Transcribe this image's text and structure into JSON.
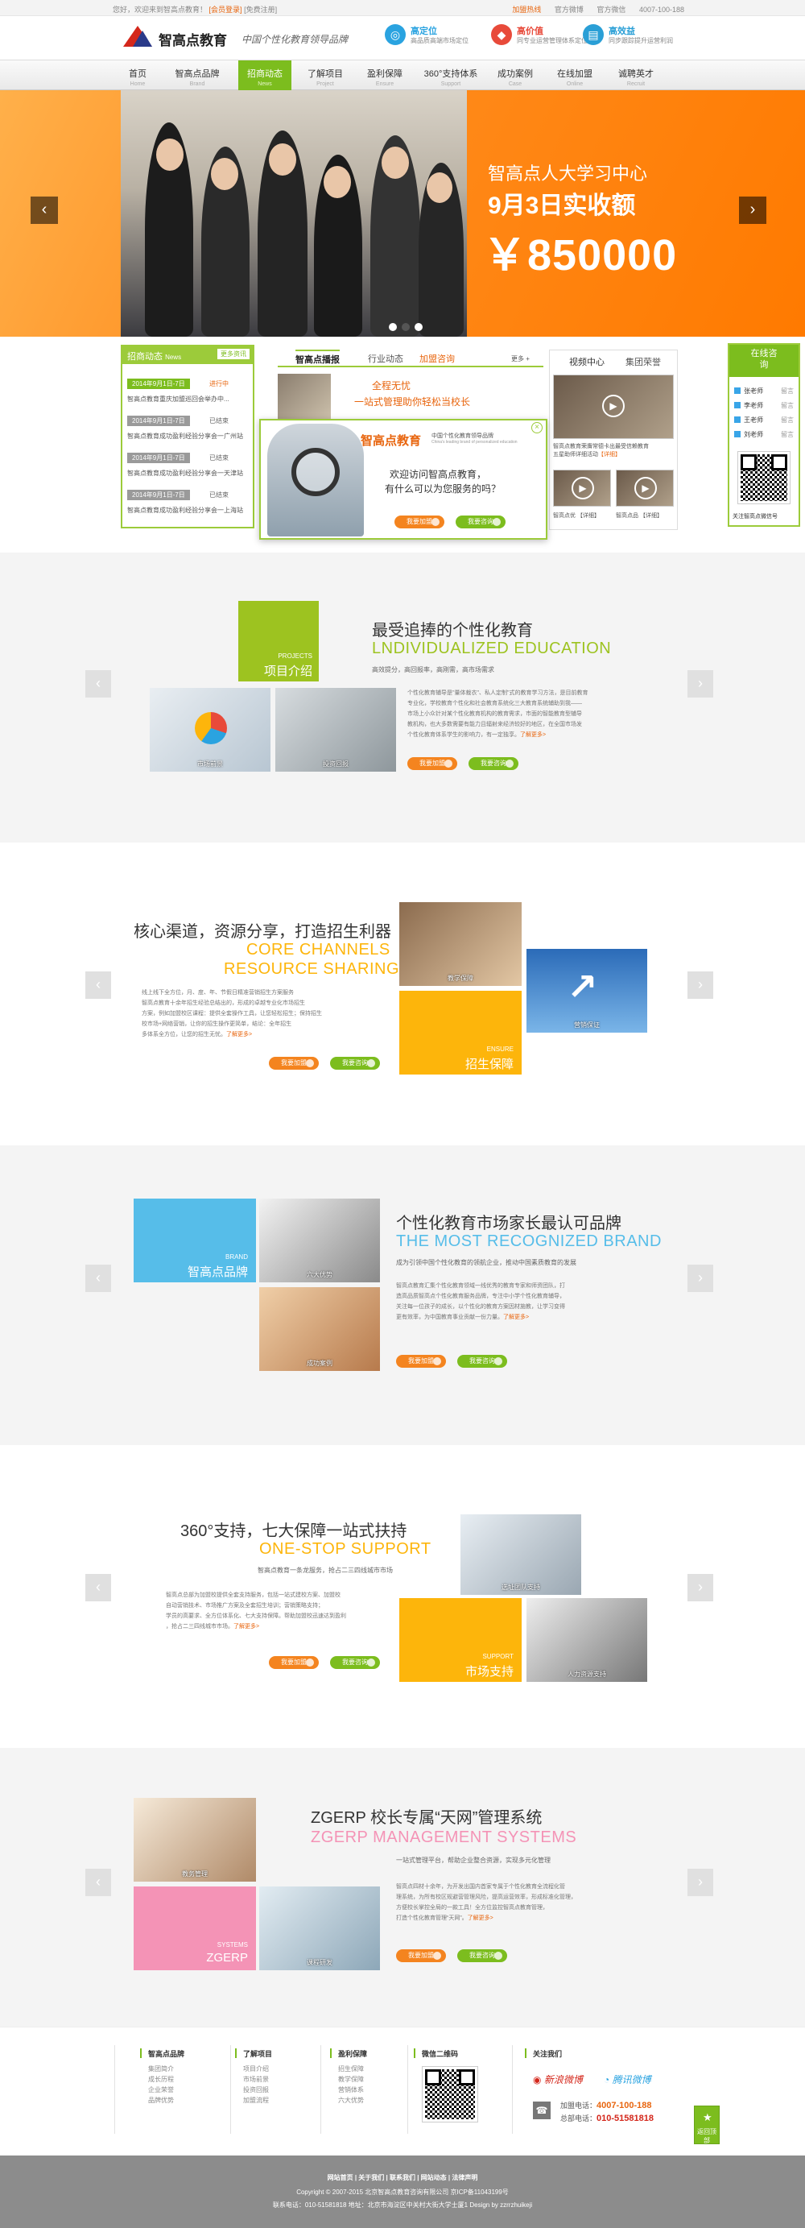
{
  "topbar": {
    "welcome": "您好，欢迎来到智高点教育！",
    "login": "[会员登录]",
    "register": "[免费注册]",
    "links": [
      "加盟热线",
      "官方微博",
      "官方微信",
      "4007-100-188"
    ]
  },
  "header": {
    "logo_text": "智高点教育",
    "slogan": "中国个性化教育领导品牌",
    "badges": [
      {
        "title": "高定位",
        "sub": "高品质高端市场定位",
        "color": "#2aa3e0"
      },
      {
        "title": "高价值",
        "sub": "同专业运营管理体系定位",
        "color": "#e84a3a"
      },
      {
        "title": "高效益",
        "sub": "同步跟踪提升运营利润",
        "color": "#2a9fd6"
      }
    ]
  },
  "nav": [
    {
      "label": "首页",
      "en": "Home"
    },
    {
      "label": "智高点品牌",
      "en": "Brand"
    },
    {
      "label": "招商动态",
      "en": "News"
    },
    {
      "label": "了解项目",
      "en": "Project"
    },
    {
      "label": "盈利保障",
      "en": "Ensure"
    },
    {
      "label": "360°支持体系",
      "en": "Support"
    },
    {
      "label": "成功案例",
      "en": "Case"
    },
    {
      "label": "在线加盟",
      "en": "Online"
    },
    {
      "label": "诚聘英才",
      "en": "Recruit"
    }
  ],
  "hero": {
    "line1": "智高点人大学习中心",
    "line2": "9月3日实收额",
    "amount": "￥850000",
    "prev": "‹",
    "next": "›"
  },
  "news": {
    "title": "招商动态",
    "title_en": "News",
    "more": "更多资讯",
    "items": [
      {
        "date": "2014年9月1日-7日",
        "status": "进行中",
        "text": "智高点教育重庆加盟巡回会举办中..."
      },
      {
        "date": "2014年9月1日-7日",
        "status": "已结束",
        "text": "智高点教育成功盈利经验分享会一广州站"
      },
      {
        "date": "2014年9月1日-7日",
        "status": "已结束",
        "text": "智高点教育成功盈利经验分享会一天津站"
      },
      {
        "date": "2014年9月1日-7日",
        "status": "已结束",
        "text": "智高点教育成功盈利经验分享会一上海站"
      }
    ]
  },
  "midtabs": {
    "tabs": [
      "智高点播报",
      "行业动态",
      "加盟咨询"
    ],
    "more": "更多 +",
    "headline1": "全程无忧",
    "headline2": "一站式管理助你轻松当校长"
  },
  "video": {
    "tabs": [
      "视频中心",
      "集团荣誉"
    ],
    "cap1": "智高点教育荣膺常德卡出最受信赖教育",
    "cap2": "五星助师详细活动",
    "detail": "【详细】",
    "cap3": "智高点优 【详细】",
    "cap4": "智高点品 【详细】"
  },
  "online": {
    "title": "在线咨询",
    "teachers": [
      {
        "name": "张老师",
        "state": "留言"
      },
      {
        "name": "李老师",
        "state": "留言"
      },
      {
        "name": "王老师",
        "state": "留言"
      },
      {
        "name": "刘老师",
        "state": "留言"
      }
    ],
    "qr_caption": "关注智高点微信号"
  },
  "popup": {
    "logo": "智高点教育",
    "tag1": "中国个性化教育领导品牌",
    "tag2": "China's leading brand of personalized education",
    "msg1": "欢迎访问智高点教育，",
    "msg2": "有什么可以为您服务的吗？",
    "join": "我要加盟",
    "consult": "我要咨询",
    "close": "×"
  },
  "sections": [
    {
      "title_cn": "最受追捧的个性化教育",
      "title_en": "LNDIVIDUALIZED EDUCATION",
      "sub": "高效提分，高回报率，高刚需，高市场需求",
      "tile_en": "PROJECTS",
      "tile_cn": "项目介绍",
      "photos": [
        "市场前景",
        "投资回报"
      ],
      "para": [
        "个性化教育辅导是\"量体裁衣\"、私人定制\"式的教育学习方法，是目前教育",
        "专业化，学校教育个性化和社会教育系统化三大教育系统辅助到我——",
        "市场上小众针对某个性化教育机构的教育需求，市面的智能教育型辅导",
        "教机构，也大多数需要有能力且辐射来经济较好的地区，在全国市场发",
        "个性化教育体系学生的影响力，有一定独享。"
      ],
      "more": "了解更多>"
    },
    {
      "title_cn": "核心渠道，资源分享，打造招生利器",
      "title_en1": "CORE CHANNELS",
      "title_en2": "RESOURCE SHARING",
      "tile_en": "ENSURE",
      "tile_cn": "招生保障",
      "photos": [
        "教学保障",
        "营销保证"
      ],
      "para": [
        "线上线下全方位，月、度、年、节假日精准营销招生方案服务",
        "智高点教育十余年招生经验总结出的，形成的卓越专业化市场招生",
        "方案，例如加盟校区课程：提供全套操作工具，让您轻松招生；保持招生",
        "校市场+网络营销，让你的招生操作更简单，结论：全年招生",
        "多体系全方位，让您的招生无忧。"
      ],
      "more": "了解更多>"
    },
    {
      "title_cn": "个性化教育市场家长最认可品牌",
      "title_en": "THE MOST RECOGNIZED BRAND",
      "sub": "成为引领中国个性化教育的领航企业，推动中国素质教育的发展",
      "tile_en": "BRAND",
      "tile_cn": "智高点品牌",
      "photos": [
        "六大优势",
        "成功案例"
      ],
      "para": [
        "智高点教育汇集个性化教育领域一线优秀的教育专家和师资团队，打",
        "造高品质智高点个性化教育服务品牌，专注中小学个性化教育辅导，",
        "关注每一位孩子的成长，以个性化的教育方案因材施教，让学习变得",
        "更有效率，为中国教育事业贡献一份力量。"
      ],
      "more": "了解更多>"
    },
    {
      "title_cn": "360°支持，七大保障一站式扶持",
      "title_en": "ONE-STOP SUPPORT",
      "sub": "智高点教育一条龙服务，抢占二三四线城市市场",
      "tile_en": "SUPPORT",
      "tile_cn": "市场支持",
      "photos": [
        "选址团队支持",
        "人力资源支持"
      ],
      "para": [
        "智高点总部为加盟校提供全套支持服务，包括一站式建校方案、加盟校",
        "自动营销技术、市场推广方案及全套招生培训；营销策略支持；",
        "学员的高要求、全方位体系化、七大支持保障。帮助加盟校迅速达到盈利",
        "，抢占二三四线城市市场。"
      ],
      "more": "了解更多>"
    },
    {
      "title_cn": "ZGERP 校长专属“天网”管理系统",
      "title_en": "ZGERP MANAGEMENT SYSTEMS",
      "sub": "一站式管理平台，帮助企业整合资源，实现多元化管理",
      "tile_en": "SYSTEMS",
      "tile_cn": "ZGERP",
      "photos": [
        "教务管理",
        "课程研发"
      ],
      "para": [
        "智高点四材十余年，为开发出国内首家专属于个性化教育全流程化管",
        "理系统，为所有校区规避营管理风险，提高运营效率，形成标准化管理，",
        "方便校长掌控全局的一款工具！全方位监控智高点教育管理，",
        "打造个性化教育管理“天网”。"
      ],
      "more": "了解更多>"
    }
  ],
  "buttons": {
    "join": "我要加盟",
    "consult": "我要咨询",
    "prev": "‹",
    "next": "›"
  },
  "footer": {
    "cols": [
      {
        "title": "智高点品牌",
        "items": [
          "集团简介",
          "成长历程",
          "企业荣誉",
          "品牌优势"
        ]
      },
      {
        "title": "了解项目",
        "items": [
          "项目介绍",
          "市场前景",
          "投资回报",
          "加盟流程"
        ]
      },
      {
        "title": "盈利保障",
        "items": [
          "招生保障",
          "教学保障",
          "营销体系",
          "六大优势"
        ]
      }
    ],
    "qr_title": "微信二维码",
    "follow_title": "关注我们",
    "weibo": "新浪微博",
    "tweibo": "腾讯微博",
    "phone_label": "加盟电话：",
    "phone": "4007-100-188",
    "hq_label": "总部电话：",
    "hq": "010-51581818",
    "backtop": "返回顶部"
  },
  "bottom": {
    "links": "网站首页  |  关于我们  |  联系我们  |  网站动态  |  法律声明",
    "copyright": "Copyright © 2007-2015  北京智高点教育咨询有限公司  京ICP备11043199号",
    "address": "联系电话：010-51581818    地址：北京市海淀区中关村大街大学士厦1 Design by zzrrzhuikeji"
  },
  "colors": {
    "accent": "#7cbd1e",
    "orange": "#f4841f",
    "tile_green": "#9dc320",
    "tile_blue": "#56bde9",
    "tile_yellow": "#fdb50b",
    "tile_pink": "#f493b6"
  }
}
